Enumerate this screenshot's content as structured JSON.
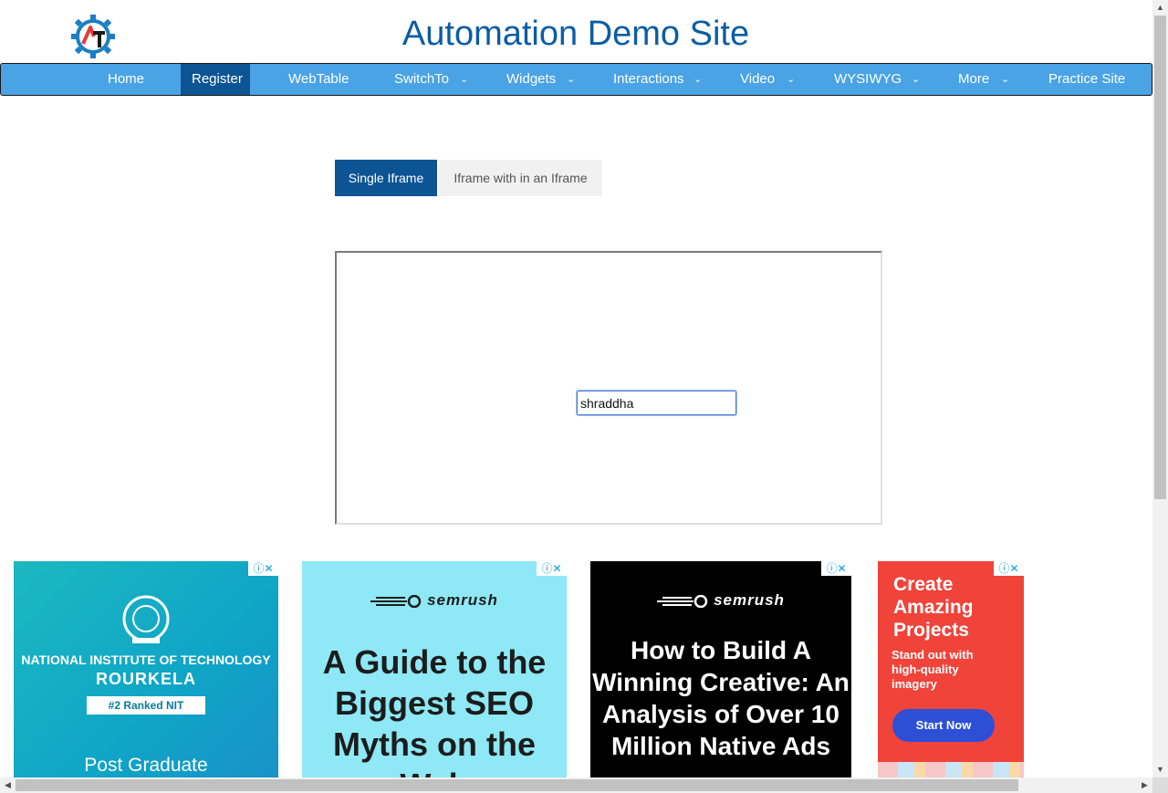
{
  "header": {
    "title": "Automation Demo Site",
    "logo_icon": "gear-logo-icon"
  },
  "nav": {
    "items": [
      {
        "label": "Home",
        "dropdown": false,
        "active": false
      },
      {
        "label": "Register",
        "dropdown": false,
        "active": true
      },
      {
        "label": "WebTable",
        "dropdown": false,
        "active": false
      },
      {
        "label": "SwitchTo",
        "dropdown": true,
        "active": false
      },
      {
        "label": "Widgets",
        "dropdown": true,
        "active": false
      },
      {
        "label": "Interactions",
        "dropdown": true,
        "active": false
      },
      {
        "label": "Video",
        "dropdown": true,
        "active": false
      },
      {
        "label": "WYSIWYG",
        "dropdown": true,
        "active": false
      },
      {
        "label": "More",
        "dropdown": true,
        "active": false
      },
      {
        "label": "Practice Site",
        "dropdown": false,
        "active": false
      }
    ],
    "chevron": "⌄"
  },
  "tabs": [
    {
      "label": "Single Iframe",
      "active": true
    },
    {
      "label": "Iframe with in an Iframe",
      "active": false
    }
  ],
  "iframe": {
    "input_value": "shraddha"
  },
  "ads": {
    "close_glyph": "ⓘ✕",
    "ad1": {
      "line1": "NATIONAL INSTITUTE OF TECHNOLOGY",
      "line2": "ROURKELA",
      "ribbon": "#2 Ranked NIT",
      "line3": "Post Graduate"
    },
    "ad2": {
      "brand": "semrush",
      "headline": "A Guide to the Biggest SEO Myths on the Web"
    },
    "ad3": {
      "brand": "semrush",
      "headline": "How to Build A Winning Creative: An Analysis of Over 10 Million Native Ads"
    },
    "ad4": {
      "headline": "Create Amazing Projects",
      "sub": "Stand out with high-quality imagery",
      "button": "Start Now"
    }
  },
  "colors": {
    "nav_bg": "#4aa3e5",
    "nav_active": "#0d5495",
    "title": "#0b5ca5"
  }
}
